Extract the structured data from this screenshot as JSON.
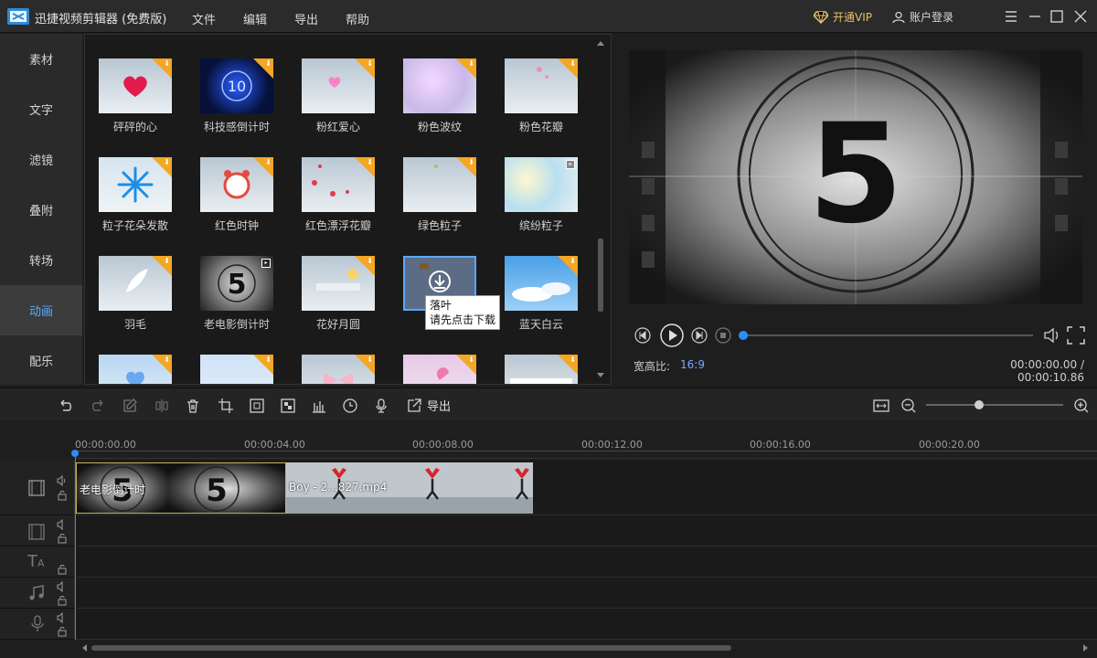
{
  "titlebar": {
    "app_title": "迅捷视频剪辑器 (免费版)",
    "menus": [
      "文件",
      "编辑",
      "导出",
      "帮助"
    ],
    "vip": "开通VIP",
    "login": "账户登录"
  },
  "leftnav": {
    "items": [
      "素材",
      "文字",
      "滤镜",
      "叠附",
      "转场",
      "动画",
      "配乐"
    ],
    "active_index": 5
  },
  "grid": {
    "tiles": [
      {
        "label": "砰砰的心",
        "badge": "download",
        "icon": "heart-icon"
      },
      {
        "label": "科技感倒计时",
        "badge": "download",
        "icon": "countdown-icon"
      },
      {
        "label": "粉红爱心",
        "badge": "download",
        "icon": "heart-icon"
      },
      {
        "label": "粉色波纹",
        "badge": "download",
        "icon": "sparkle-icon"
      },
      {
        "label": "粉色花瓣",
        "badge": "download",
        "icon": "petal-icon"
      },
      {
        "label": "粒子花朵发散",
        "badge": "download",
        "icon": "flower-icon"
      },
      {
        "label": "红色时钟",
        "badge": "download",
        "icon": "alarm-clock-icon"
      },
      {
        "label": "红色漂浮花瓣",
        "badge": "download",
        "icon": "petal-icon"
      },
      {
        "label": "绿色粒子",
        "badge": "download",
        "icon": "particle-icon"
      },
      {
        "label": "缤纷粒子",
        "badge": "play",
        "icon": "particle-icon"
      },
      {
        "label": "羽毛",
        "badge": "download",
        "icon": "feather-icon"
      },
      {
        "label": "老电影倒计时",
        "badge": "play",
        "icon": "film-countdown-icon"
      },
      {
        "label": "花好月圆",
        "badge": "download",
        "icon": "moon-icon"
      },
      {
        "label": "",
        "badge": "hover",
        "icon": "leaf-icon"
      },
      {
        "label": "蓝天白云",
        "badge": "download",
        "icon": "cloud-icon"
      },
      {
        "label": "",
        "badge": "download",
        "icon": "heart-icon"
      },
      {
        "label": "",
        "badge": "download",
        "icon": "bubble-icon"
      },
      {
        "label": "",
        "badge": "download",
        "icon": "bow-icon"
      },
      {
        "label": "",
        "badge": "download",
        "icon": "petal-icon"
      },
      {
        "label": "",
        "badge": "download",
        "icon": "frame-icon"
      }
    ],
    "tooltip": [
      "落叶",
      "请先点击下载"
    ]
  },
  "preview": {
    "countdown_number": "5",
    "progress": 0
  },
  "info": {
    "aspect_label": "宽高比:",
    "aspect_value": "16:9",
    "timecode": "00:00:00.00 / 00:00:10.86"
  },
  "toolbar": {
    "export_label": "导出"
  },
  "timeline": {
    "ticks": [
      "00:00:00.00",
      "00:00:04.00",
      "00:00:08.00",
      "00:00:12.00",
      "00:00:16.00",
      "00:00:20.00"
    ],
    "clips": [
      {
        "label": "老电影倒计时"
      },
      {
        "label": "Boy - 2...827.mp4"
      }
    ]
  },
  "colors": {
    "accent": "#5aa8ff",
    "vip": "#e8c06a",
    "download_badge": "#f5a623",
    "clip_border": "#c8b25a"
  }
}
